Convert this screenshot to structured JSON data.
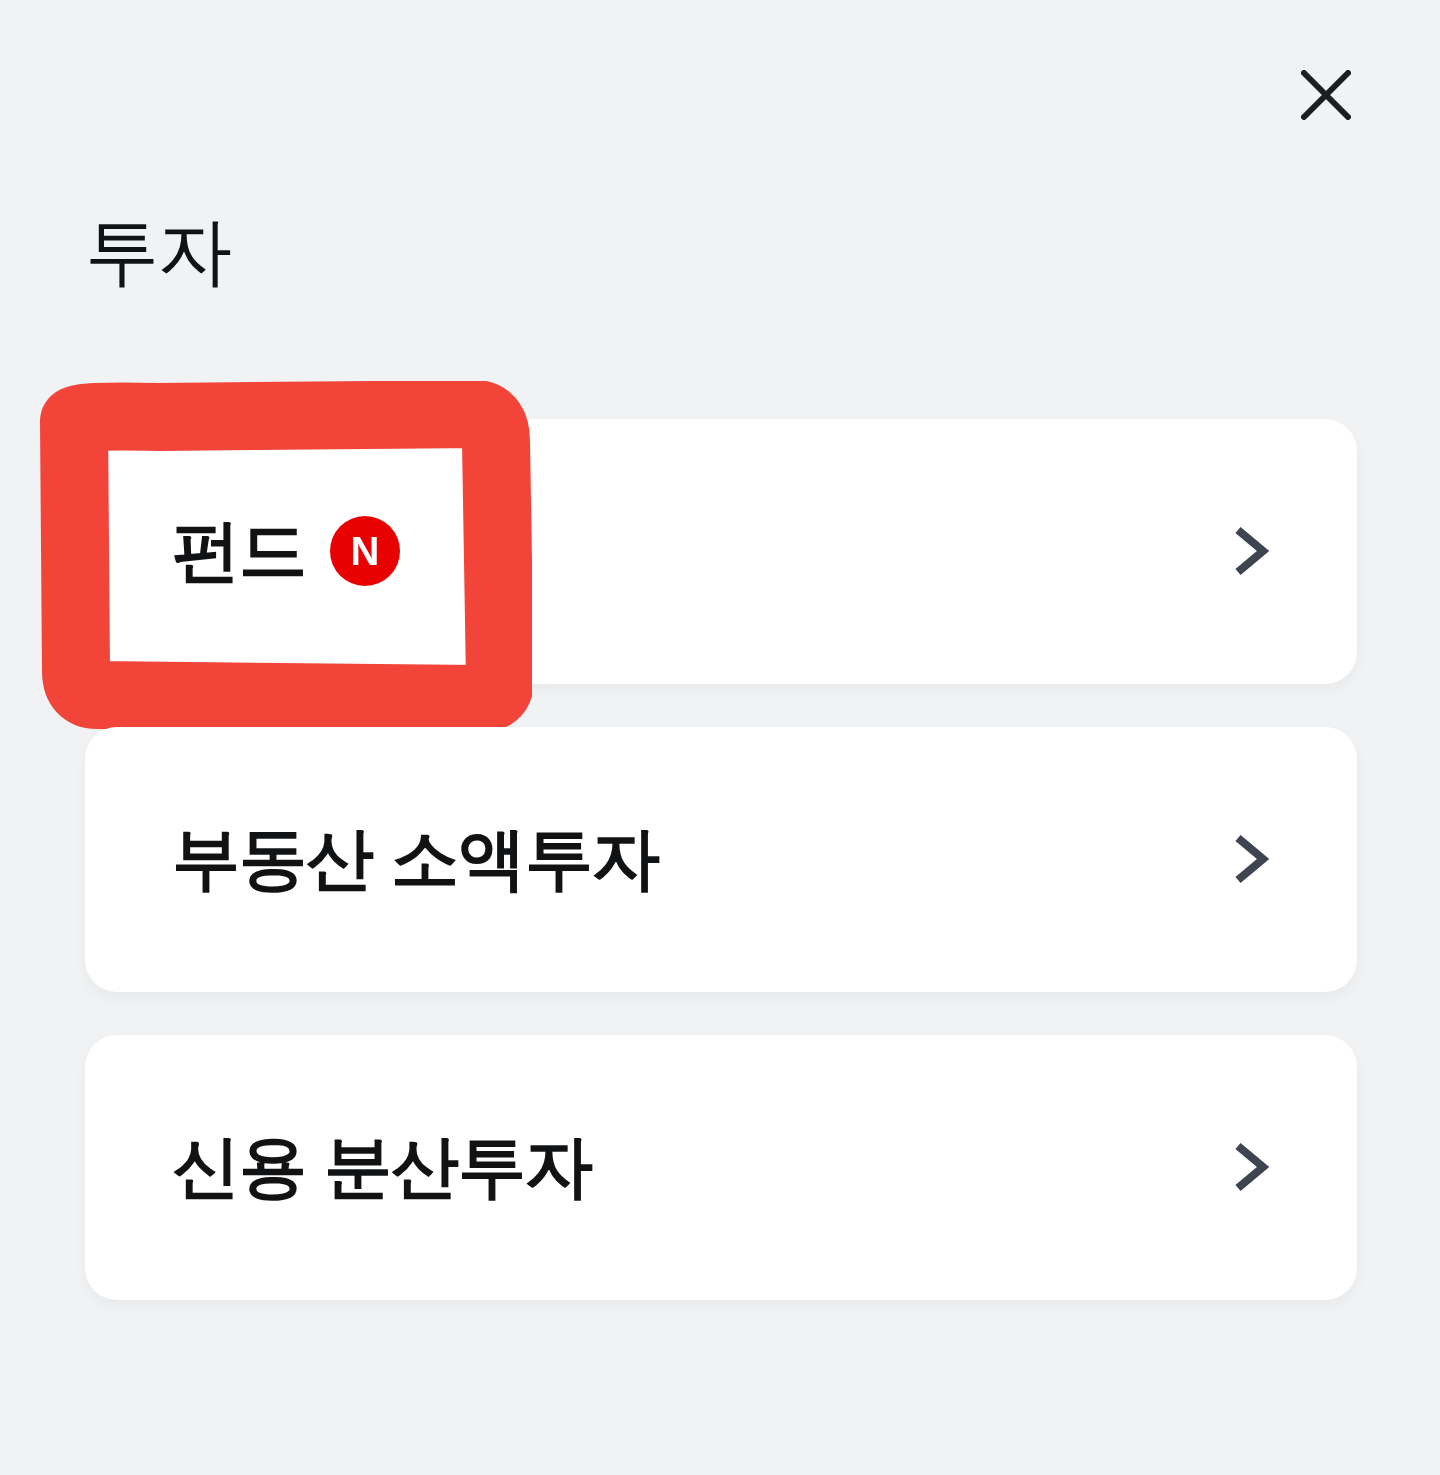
{
  "header": {
    "title": "투자"
  },
  "menu_items": [
    {
      "label": "펀드",
      "badge": "N",
      "highlighted": true
    },
    {
      "label": "부동산 소액투자",
      "highlighted": false
    },
    {
      "label": "신용 분산투자",
      "highlighted": false
    }
  ]
}
